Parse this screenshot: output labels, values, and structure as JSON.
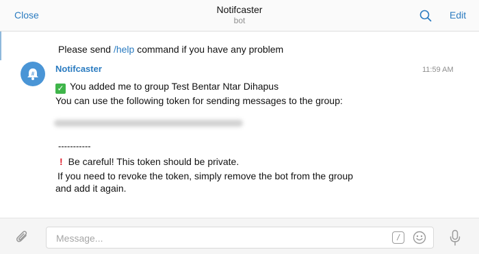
{
  "header": {
    "close_label": "Close",
    "title": "Notifcaster",
    "subtitle": "bot",
    "edit_label": "Edit"
  },
  "chat": {
    "help_prefix": "Please send ",
    "help_command": "/help",
    "help_suffix": " command if you have any problem",
    "message": {
      "sender": "Notifcaster",
      "time": "11:59 AM",
      "line1": "You added me to group Test Bentar Ntar Dihapus",
      "line2": "You can use the following token for sending messages to the group:",
      "separator": "-----------",
      "warning": "Be careful! This token should be private.",
      "line3": "If you need to revoke the token, simply remove the bot from the group",
      "line4": "and add it again."
    }
  },
  "composer": {
    "placeholder": "Message...",
    "value": ""
  },
  "colors": {
    "accent": "#2a7bc0",
    "avatar": "#4a95d6",
    "check": "#3fb54a",
    "warning": "#e0202e"
  },
  "icons": {
    "search": "search-icon",
    "attach": "paperclip-icon",
    "command": "slash-command-icon",
    "emoji": "emoji-icon",
    "mic": "microphone-icon",
    "avatar": "bell-bot-icon"
  }
}
